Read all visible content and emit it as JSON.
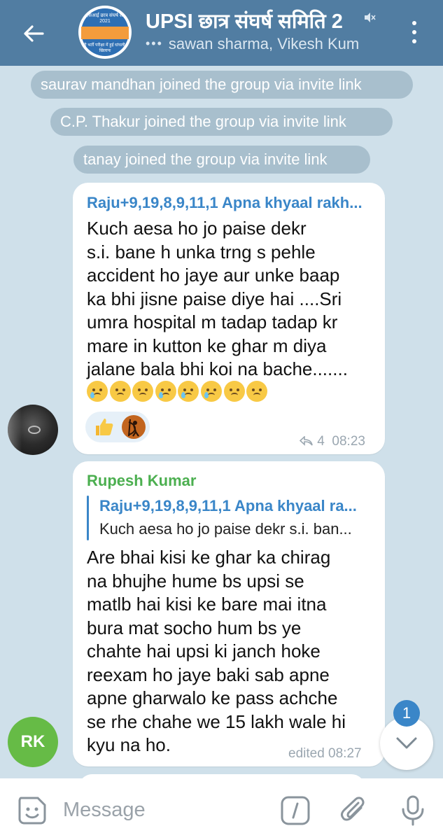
{
  "header": {
    "title": "UPSI छात्र संघर्ष समिति 2",
    "subtitle": "sawan sharma, Vikesh Kum",
    "typing_dots": "•••",
    "avatar_text_top": "यूपीएसआई छात्र संघर्ष समिति 2021",
    "avatar_text_bottom": "यूपी भर्ती परीक्षा में हुई धांधली के खिलाफ"
  },
  "service_messages": [
    "saurav mandhan joined the group via invite link",
    "C.P. Thakur joined the group via invite link",
    "tanay joined the group via invite link"
  ],
  "message1": {
    "reply_ref": "Raju+9,19,8,9,11,1 Apna khyaal rakh...",
    "text_lines": [
      "Kuch aesa ho jo paise dekr",
      "s.i. bane h unka trng s pehle",
      "accident ho jaye aur unke baap",
      "ka bhi jisne paise diye hai ....Sri",
      "umra hospital m tadap tadap kr",
      "mare in kutton ke ghar m diya",
      "jalane bala bhi koi na bache......."
    ],
    "emoji_count": "8",
    "reactions": [
      "thumbs-up",
      "custom-avatar"
    ],
    "reply_count": "4",
    "time": "08:23"
  },
  "message2": {
    "sender": "Rupesh Kumar",
    "quote_title": "Raju+9,19,8,9,11,1 Apna khyaal ra...",
    "quote_text": "Kuch aesa ho jo paise dekr s.i. ban...",
    "text_lines": [
      "Are bhai kisi ke ghar ka chirag",
      "na bhujhe hume bs upsi se",
      "matlb hai kisi ke bare mai itna",
      "bura mat socho hum bs ye",
      "chahte hai upsi ki janch hoke",
      "reexam ho jaye baki sab apne",
      "apne gharwalo ke pass achche",
      "se rhe chahe we 15 lakh wale hi",
      "kyu na ho."
    ],
    "meta": "edited 08:27",
    "avatar_initials": "RK"
  },
  "scroll": {
    "unread_count": "1"
  },
  "composer": {
    "placeholder": "Message"
  },
  "colors": {
    "header": "#517da2",
    "accent": "#3a86c8",
    "sender_green": "#4caf50",
    "avatar_green": "#66bb46"
  }
}
